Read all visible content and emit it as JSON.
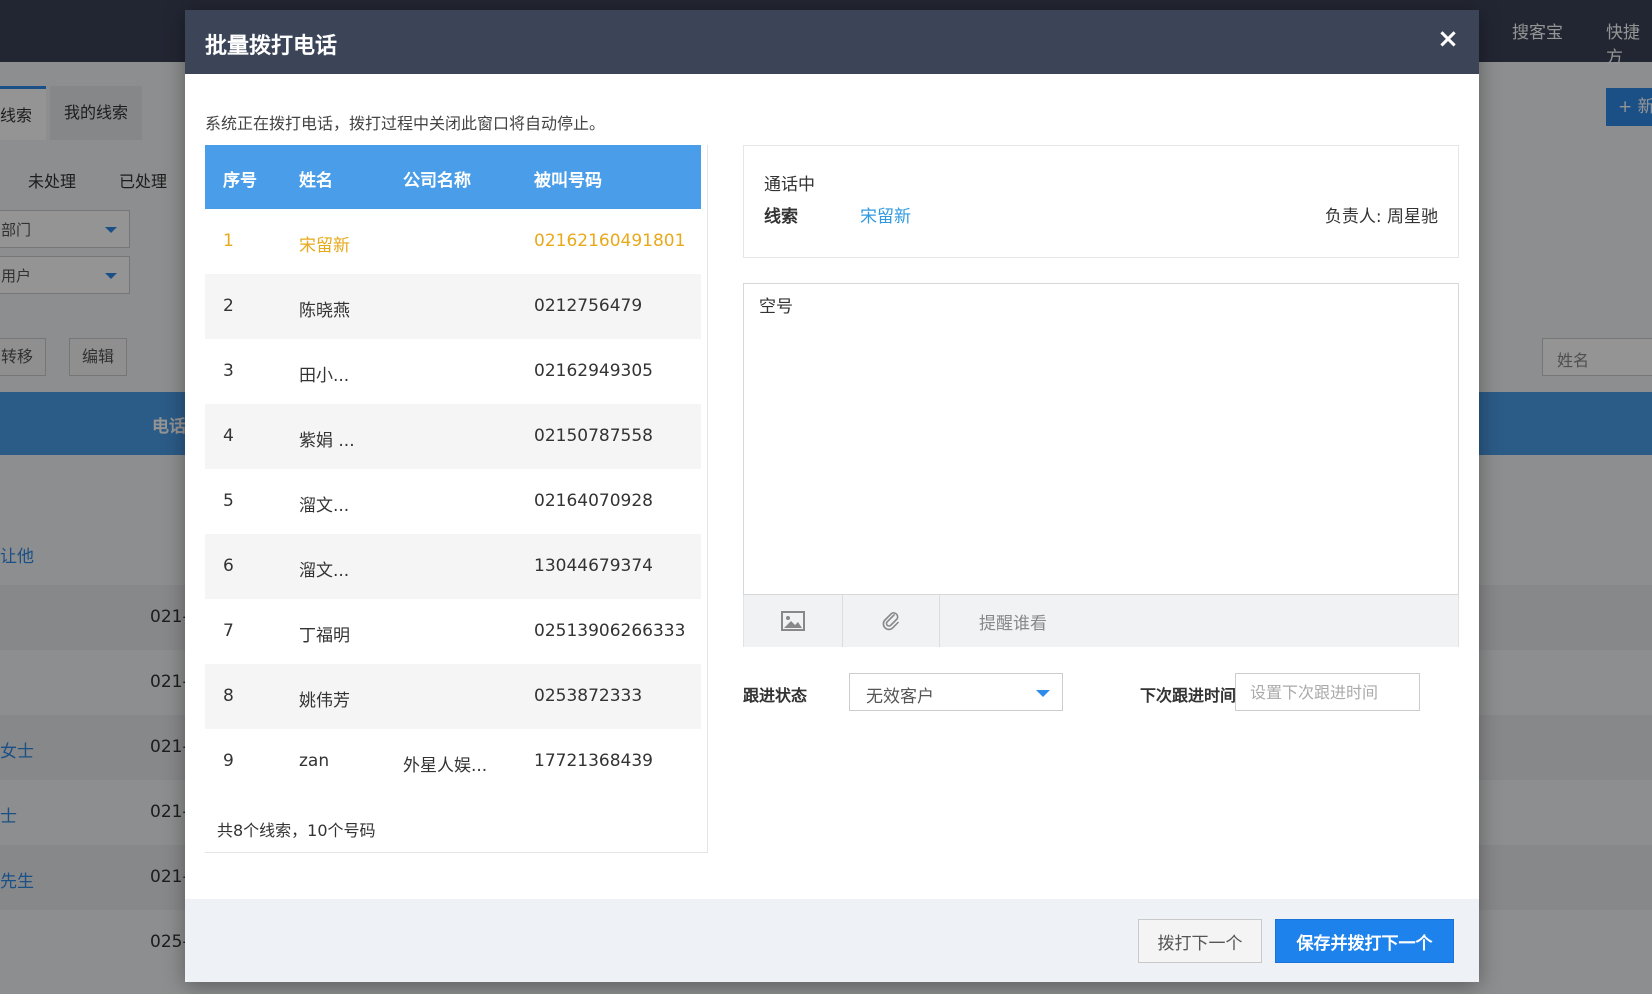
{
  "background": {
    "top_links": [
      "搜客宝",
      "快捷方"
    ],
    "tabs": [
      "线索",
      "我的线索"
    ],
    "sub_tabs": [
      "未处理",
      "已处理"
    ],
    "dept_select": "部门",
    "user_select": "用户",
    "action_buttons": [
      "转移",
      "编辑"
    ],
    "search_placeholder": "姓名",
    "new_button": "+ 新",
    "table_header_phone": "电话",
    "rows": [
      {
        "name": "让他",
        "phone": ""
      },
      {
        "name": "",
        "phone": "021-"
      },
      {
        "name": "",
        "phone": "021-"
      },
      {
        "name": "女士",
        "phone": "021-"
      },
      {
        "name": "士",
        "phone": "021-"
      },
      {
        "name": "先生",
        "phone": "021-"
      },
      {
        "name": "",
        "phone": "025-"
      }
    ]
  },
  "modal": {
    "title": "批量拨打电话",
    "close_symbol": "×",
    "notice": "系统正在拨打电话，拨打过程中关闭此窗口将自动停止。",
    "list": {
      "headers": {
        "index": "序号",
        "name": "姓名",
        "company": "公司名称",
        "phone": "被叫号码"
      },
      "rows": [
        {
          "index": "1",
          "name": "宋留新",
          "company": "",
          "phone": "02162160491801",
          "active": true
        },
        {
          "index": "2",
          "name": "陈晓燕",
          "company": "",
          "phone": "0212756479"
        },
        {
          "index": "3",
          "name": "田小...",
          "company": "",
          "phone": "02162949305"
        },
        {
          "index": "4",
          "name": "紫娟 ...",
          "company": "",
          "phone": "02150787558"
        },
        {
          "index": "5",
          "name": "溜文...",
          "company": "",
          "phone": "02164070928"
        },
        {
          "index": "6",
          "name": "溜文...",
          "company": "",
          "phone": "13044679374"
        },
        {
          "index": "7",
          "name": "丁福明",
          "company": "",
          "phone": "02513906266333"
        },
        {
          "index": "8",
          "name": "姚伟芳",
          "company": "",
          "phone": "0253872333"
        },
        {
          "index": "9",
          "name": "zan",
          "company": "外星人娱...",
          "phone": "17721368439"
        }
      ],
      "summary": "共8个线索，10个号码"
    },
    "call_info": {
      "status": "通话中",
      "label": "线索",
      "lead_name": "宋留新",
      "owner": "负责人: 周星驰"
    },
    "note": {
      "value": "空号",
      "image_icon": "image-icon",
      "attach_icon": "paperclip-icon",
      "remind": "提醒谁看"
    },
    "follow": {
      "status_label": "跟进状态",
      "status_value": "无效客户",
      "next_label": "下次跟进时间",
      "next_placeholder": "设置下次跟进时间"
    },
    "footer": {
      "skip_label": "拨打下一个",
      "save_label": "保存并拨打下一个"
    }
  }
}
